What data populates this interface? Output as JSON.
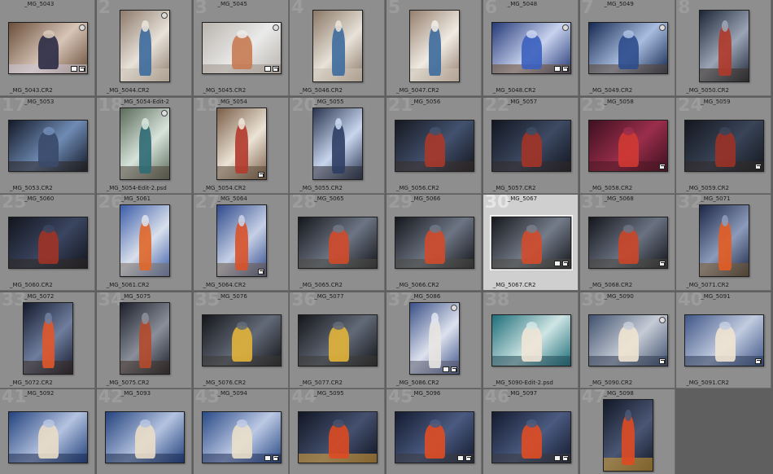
{
  "grid": {
    "columns": 8,
    "cells": [
      {
        "num": "",
        "top": "_MG_5043",
        "bottom": "_MG_5043.CR2",
        "orient": "land",
        "tone": [
          "#6b4f3a",
          "#d7c5b8",
          "#2b2b45",
          "#c8c4d6"
        ],
        "flag": true,
        "badges": 2
      },
      {
        "num": "2",
        "top": "",
        "bottom": "_MG_5044.CR2",
        "orient": "port",
        "tone": [
          "#8d7a6c",
          "#e8e2d9",
          "#3c6a9c",
          "#c8bfb2"
        ],
        "flag": true,
        "badges": 0
      },
      {
        "num": "3",
        "top": "_MG_5045",
        "bottom": "_MG_5045.CR2",
        "orient": "land",
        "tone": [
          "#b9b4ad",
          "#eaeaea",
          "#c67a52",
          "#9a8f86"
        ],
        "flag": true,
        "badges": 2
      },
      {
        "num": "4",
        "top": "",
        "bottom": "_MG_5046.CR2",
        "orient": "port",
        "tone": [
          "#8a7866",
          "#e8e2d9",
          "#3c6a9c",
          "#c8bfb2"
        ],
        "flag": false,
        "badges": 0
      },
      {
        "num": "5",
        "top": "",
        "bottom": "_MG_5047.CR2",
        "orient": "port",
        "tone": [
          "#957f6e",
          "#f0ebe3",
          "#3c6a9c",
          "#c8bfb2"
        ],
        "flag": false,
        "badges": 0
      },
      {
        "num": "6",
        "top": "_MG_5048",
        "bottom": "_MG_5048.CR2",
        "orient": "land",
        "tone": [
          "#253a78",
          "#c8d2ee",
          "#3a5fbf",
          "#6c4a2b"
        ],
        "flag": true,
        "badges": 2
      },
      {
        "num": "7",
        "top": "_MG_5049",
        "bottom": "_MG_5049.CR2",
        "orient": "land",
        "tone": [
          "#162a52",
          "#a9bde0",
          "#2c4d8c",
          "#5a4430"
        ],
        "flag": true,
        "badges": 0
      },
      {
        "num": "8",
        "top": "",
        "bottom": "_MG_5050.CR2",
        "orient": "port",
        "tone": [
          "#1d2637",
          "#9aa4b4",
          "#b03a2a",
          "#3b2f27"
        ],
        "flag": false,
        "badges": 0
      },
      {
        "num": "17",
        "top": "_MG_5053",
        "bottom": "_MG_5053.CR2",
        "orient": "land",
        "tone": [
          "#141a29",
          "#6f8bb4",
          "#3a4a6a",
          "#2a2422"
        ],
        "flag": false,
        "badges": 0
      },
      {
        "num": "18",
        "top": "_MG_5054-Edit-2",
        "bottom": "_MG_5054-Edit-2.psd",
        "orient": "port",
        "tone": [
          "#5b6a5a",
          "#d7e3da",
          "#2f6a74",
          "#4c4238"
        ],
        "flag": true,
        "badges": 0
      },
      {
        "num": "19",
        "top": "_MG_5054",
        "bottom": "_MG_5054.CR2",
        "orient": "port",
        "tone": [
          "#7a5e48",
          "#ece3d6",
          "#b23a2c",
          "#5a4838"
        ],
        "flag": false,
        "badges": 1
      },
      {
        "num": "20",
        "top": "_MG_5055",
        "bottom": "_MG_5055.CR2",
        "orient": "port",
        "tone": [
          "#2a3450",
          "#c8d6ee",
          "#2e3d63",
          "#2a2a33"
        ],
        "flag": false,
        "badges": 0
      },
      {
        "num": "21",
        "top": "_MG_5056",
        "bottom": "_MG_5056.CR2",
        "orient": "land",
        "tone": [
          "#161820",
          "#42516e",
          "#a8382a",
          "#3a2d28"
        ],
        "flag": false,
        "badges": 0
      },
      {
        "num": "22",
        "top": "_MG_5057",
        "bottom": "_MG_5057.CR2",
        "orient": "land",
        "tone": [
          "#121620",
          "#3d4a63",
          "#a33427",
          "#33292a"
        ],
        "flag": false,
        "badges": 0
      },
      {
        "num": "23",
        "top": "_MG_5058",
        "bottom": "_MG_5058.CR2",
        "orient": "land",
        "tone": [
          "#3e1021",
          "#9a2e4b",
          "#d03a33",
          "#4a1a25"
        ],
        "flag": false,
        "badges": 1
      },
      {
        "num": "24",
        "top": "_MG_5059",
        "bottom": "_MG_5059.CR2",
        "orient": "land",
        "tone": [
          "#14171e",
          "#394458",
          "#9b3227",
          "#322a26"
        ],
        "flag": false,
        "badges": 1
      },
      {
        "num": "25",
        "top": "_MG_5060",
        "bottom": "_MG_5060.CR2",
        "orient": "land",
        "tone": [
          "#13161e",
          "#3a4560",
          "#a03326",
          "#302824"
        ],
        "flag": false,
        "badges": 0
      },
      {
        "num": "26",
        "top": "_MG_5061",
        "bottom": "_MG_5061.CR2",
        "orient": "port",
        "tone": [
          "#3c5da8",
          "#d9e0ec",
          "#e0672a",
          "#7a6f66"
        ],
        "flag": false,
        "badges": 0
      },
      {
        "num": "27",
        "top": "_MG_5064",
        "bottom": "_MG_5064.CR2",
        "orient": "port",
        "tone": [
          "#2f4a8c",
          "#c6d0e6",
          "#d9522a",
          "#6b5a4b"
        ],
        "flag": false,
        "badges": 1
      },
      {
        "num": "28",
        "top": "_MG_5065",
        "bottom": "_MG_5065.CR2",
        "orient": "land",
        "tone": [
          "#15171c",
          "#6d7584",
          "#d14a2a",
          "#4c4a44"
        ],
        "flag": false,
        "badges": 0
      },
      {
        "num": "29",
        "top": "_MG_5066",
        "bottom": "_MG_5066.CR2",
        "orient": "land",
        "tone": [
          "#15171c",
          "#6d7584",
          "#d14a2a",
          "#4c4a44"
        ],
        "flag": false,
        "badges": 0
      },
      {
        "num": "30",
        "top": "_MG_5067",
        "bottom": "_MG_5067.CR2",
        "orient": "land",
        "tone": [
          "#16181d",
          "#747c8a",
          "#d34b2b",
          "#4f4c46"
        ],
        "flag": false,
        "badges": 2,
        "selected": true
      },
      {
        "num": "31",
        "top": "_MG_5068",
        "bottom": "_MG_5068.CR2",
        "orient": "land",
        "tone": [
          "#14161b",
          "#6a7282",
          "#cc4628",
          "#4a4740"
        ],
        "flag": false,
        "badges": 1
      },
      {
        "num": "32",
        "top": "_MG_5071",
        "bottom": "_MG_5071.CR2",
        "orient": "port",
        "tone": [
          "#1c2744",
          "#8c9abb",
          "#e35c22",
          "#7a5a2a"
        ],
        "flag": false,
        "badges": 0
      },
      {
        "num": "33",
        "top": "_MG_5072",
        "bottom": "_MG_5072.CR2",
        "orient": "port",
        "tone": [
          "#141a2c",
          "#6f7e9e",
          "#e0562a",
          "#3a2a22"
        ],
        "flag": false,
        "badges": 0
      },
      {
        "num": "34",
        "top": "_MG_5075",
        "bottom": "_MG_5075.CR2",
        "orient": "port",
        "tone": [
          "#1c1f2a",
          "#8a8f9a",
          "#b44a2c",
          "#3e2f27"
        ],
        "flag": false,
        "badges": 0
      },
      {
        "num": "35",
        "top": "_MG_5076",
        "bottom": "_MG_5076.CR2",
        "orient": "land",
        "tone": [
          "#15161a",
          "#626a78",
          "#e2b43a",
          "#3c3a36"
        ],
        "flag": false,
        "badges": 0
      },
      {
        "num": "36",
        "top": "_MG_5077",
        "bottom": "_MG_5077.CR2",
        "orient": "land",
        "tone": [
          "#15161a",
          "#626a78",
          "#e2b43a",
          "#3c3a36"
        ],
        "flag": false,
        "badges": 0
      },
      {
        "num": "37",
        "top": "_MG_5086",
        "bottom": "_MG_5086.CR2",
        "orient": "port",
        "tone": [
          "#3a4f86",
          "#dde2ee",
          "#e8e6e2",
          "#5a5a6a"
        ],
        "flag": true,
        "badges": 2
      },
      {
        "num": "38",
        "top": "",
        "bottom": "_MG_5090-Edit-2.psd",
        "orient": "land",
        "tone": [
          "#1e6e7a",
          "#cfe5e4",
          "#efe6d6",
          "#234a55"
        ],
        "flag": false,
        "badges": 0
      },
      {
        "num": "39",
        "top": "_MG_5090",
        "bottom": "_MG_5090.CR2",
        "orient": "land",
        "tone": [
          "#40516e",
          "#c6ccd6",
          "#efe4d1",
          "#2f3a50"
        ],
        "flag": true,
        "badges": 1
      },
      {
        "num": "40",
        "top": "_MG_5091",
        "bottom": "_MG_5091.CR2",
        "orient": "land",
        "tone": [
          "#405687",
          "#c2cce0",
          "#efe4d1",
          "#2d3a58"
        ],
        "flag": false,
        "badges": 1
      },
      {
        "num": "41",
        "top": "_MG_5092",
        "bottom": "_MG_5092.CR2",
        "orient": "land",
        "tone": [
          "#23427d",
          "#b4c3e0",
          "#e9ddc8",
          "#1e2e52"
        ],
        "flag": false,
        "badges": 0
      },
      {
        "num": "42",
        "top": "_MG_5093",
        "bottom": "_MG_5093.CR2",
        "orient": "land",
        "tone": [
          "#23427d",
          "#b4c3e0",
          "#e9ddc8",
          "#1e2e52"
        ],
        "flag": false,
        "badges": 0
      },
      {
        "num": "43",
        "top": "_MG_5094",
        "bottom": "_MG_5094.CR2",
        "orient": "land",
        "tone": [
          "#2a4a86",
          "#bcc9e4",
          "#eadfca",
          "#20305a"
        ],
        "flag": false,
        "badges": 2
      },
      {
        "num": "44",
        "top": "_MG_5095",
        "bottom": "_MG_5095.CR2",
        "orient": "land",
        "tone": [
          "#111624",
          "#44506e",
          "#dd4a22",
          "#e2a53a"
        ],
        "flag": false,
        "badges": 0
      },
      {
        "num": "45",
        "top": "_MG_5096",
        "bottom": "_MG_5096.CR2",
        "orient": "land",
        "tone": [
          "#141b30",
          "#4a5a80",
          "#e04c24",
          "#3a3a40"
        ],
        "flag": false,
        "badges": 2
      },
      {
        "num": "46",
        "top": "_MG_5097",
        "bottom": "_MG_5097.CR2",
        "orient": "land",
        "tone": [
          "#141b30",
          "#4a5a80",
          "#e04c24",
          "#3a3a40"
        ],
        "flag": false,
        "badges": 2
      },
      {
        "num": "47",
        "top": "_MG_5098",
        "bottom": "_MG_5098.CR2",
        "orient": "port",
        "tone": [
          "#121827",
          "#4a5674",
          "#df4a22",
          "#d9a030"
        ],
        "flag": false,
        "badges": 0
      }
    ]
  }
}
